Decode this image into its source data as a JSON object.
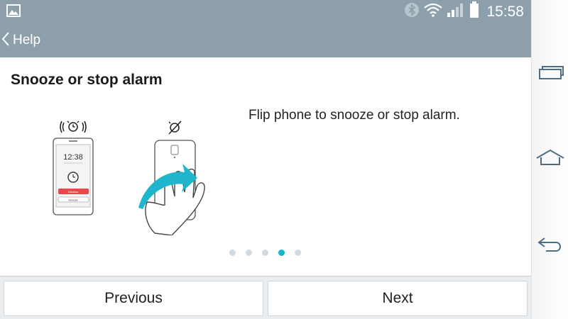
{
  "status_bar": {
    "time": "15:58",
    "icons": [
      "gallery-icon",
      "bluetooth-icon",
      "wifi-icon",
      "signal-icon",
      "battery-icon"
    ]
  },
  "action_bar": {
    "back_label": "Help"
  },
  "content": {
    "title": "Snooze or stop alarm",
    "description": "Flip phone to snooze or stop alarm.",
    "illustration": {
      "phone_time": "12:38",
      "phone_buttons": [
        "Dismiss",
        "Snooze"
      ]
    },
    "pager": {
      "total": 5,
      "current": 4
    }
  },
  "footer": {
    "previous_label": "Previous",
    "next_label": "Next"
  },
  "navbar": {
    "keys": [
      "recent-apps-icon",
      "home-icon",
      "back-icon"
    ]
  },
  "colors": {
    "action_bar": "#8c9fab",
    "accent": "#19b5c8",
    "alarm_button": "#e8474c"
  }
}
